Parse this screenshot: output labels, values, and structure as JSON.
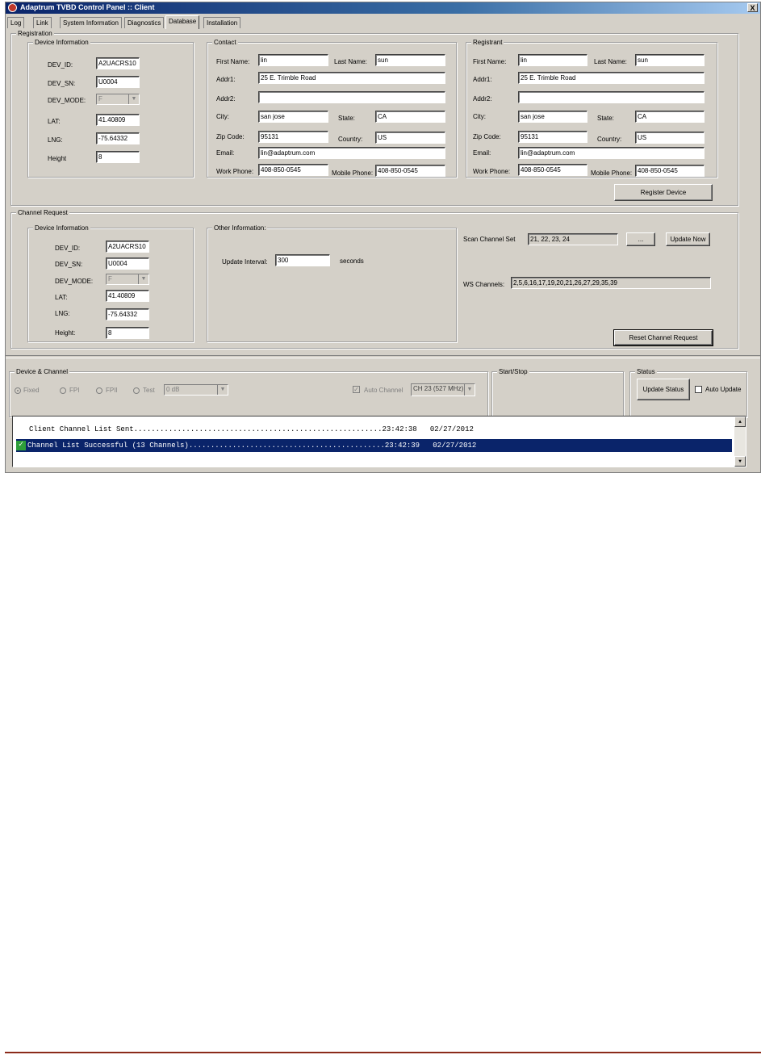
{
  "window": {
    "title": "Adaptrum TVBD Control Panel :: Client",
    "close_glyph": "X"
  },
  "tabs": [
    "Log",
    "Link",
    "System Information",
    "Diagnostics",
    "Database",
    "Installation"
  ],
  "registration": {
    "legend": "Registration",
    "device_info": {
      "legend": "Device Information",
      "dev_id_label": "DEV_ID:",
      "dev_id": "A2UACRS10",
      "dev_sn_label": "DEV_SN:",
      "dev_sn": "U0004",
      "dev_mode_label": "DEV_MODE:",
      "dev_mode": "F",
      "lat_label": "LAT:",
      "lat": "41.40809",
      "lng_label": "LNG:",
      "lng": "-75.64332",
      "height_label": "Height",
      "height": "8"
    },
    "contact": {
      "legend": "Contact",
      "first_name_label": "First Name:",
      "first_name": "lin",
      "last_name_label": "Last Name:",
      "last_name": "sun",
      "addr1_label": "Addr1:",
      "addr1": "25 E. Trimble Road",
      "addr2_label": "Addr2:",
      "addr2": "",
      "city_label": "City:",
      "city": "san jose",
      "state_label": "State:",
      "state": "CA",
      "zip_label": "Zip Code:",
      "zip": "95131",
      "country_label": "Country:",
      "country": "US",
      "email_label": "Email:",
      "email": "lin@adaptrum.com",
      "work_phone_label": "Work Phone:",
      "work_phone": "408-850-0545",
      "mobile_phone_label": "Mobile Phone:",
      "mobile_phone": "408-850-0545"
    },
    "registrant": {
      "legend": "Registrant",
      "first_name_label": "First Name:",
      "first_name": "lin",
      "last_name_label": "Last Name:",
      "last_name": "sun",
      "addr1_label": "Addr1:",
      "addr1": "25 E. Trimble Road",
      "addr2_label": "Addr2:",
      "addr2": "",
      "city_label": "City:",
      "city": "san jose",
      "state_label": "State:",
      "state": "CA",
      "zip_label": "Zip Code:",
      "zip": "95131",
      "country_label": "Country:",
      "country": "US",
      "email_label": "Email:",
      "email": "lin@adaptrum.com",
      "work_phone_label": "Work Phone:",
      "work_phone": "408-850-0545",
      "mobile_phone_label": "Mobile Phone:",
      "mobile_phone": "408-850-0545"
    },
    "register_button": "Register Device"
  },
  "channel_request": {
    "legend": "Channel Request",
    "device_info": {
      "legend": "Device Information",
      "dev_id_label": "DEV_ID:",
      "dev_id": "A2UACRS10",
      "dev_sn_label": "DEV_SN:",
      "dev_sn": "U0004",
      "dev_mode_label": "DEV_MODE:",
      "dev_mode": "F",
      "lat_label": "LAT:",
      "lat": "41.40809",
      "lng_label": "LNG:",
      "lng": "-75.64332",
      "height_label": "Height:",
      "height": "8"
    },
    "other_info": {
      "legend": "Other Information:",
      "update_interval_label": "Update Interval:",
      "update_interval": "300",
      "seconds_label": "seconds"
    },
    "scan_channel_set_label": "Scan Channel Set",
    "scan_channel_set": "21, 22, 23, 24",
    "browse_button": "...",
    "update_now_button": "Update Now",
    "ws_channels_label": "WS Channels:",
    "ws_channels": "2,5,6,16,17,19,20,21,26,27,29,35,39",
    "reset_button": "Reset Channel Request"
  },
  "device_channel": {
    "legend": "Device & Channel",
    "radios": [
      "Fixed",
      "FPI",
      "FPII",
      "Test"
    ],
    "test_level": "0 dB",
    "auto_channel_label": "Auto Channel",
    "auto_channel_checked": true,
    "channel_select": "CH 23 (527 MHz)"
  },
  "start_stop": {
    "legend": "Start/Stop"
  },
  "status": {
    "legend": "Status",
    "update_status_button": "Update Status",
    "auto_update_label": "Auto Update"
  },
  "log": {
    "rows": [
      "Client Channel List Sent.........................................................23:42:38   02/27/2012",
      "Channel List Successful (13 Channels).............................................23:42:39   02/27/2012"
    ]
  },
  "colors": {
    "window_bg": "#d4d0c8",
    "title_bar": "#0a246a",
    "selection": "#0a246a",
    "footer_rule": "#8b2a1a"
  }
}
